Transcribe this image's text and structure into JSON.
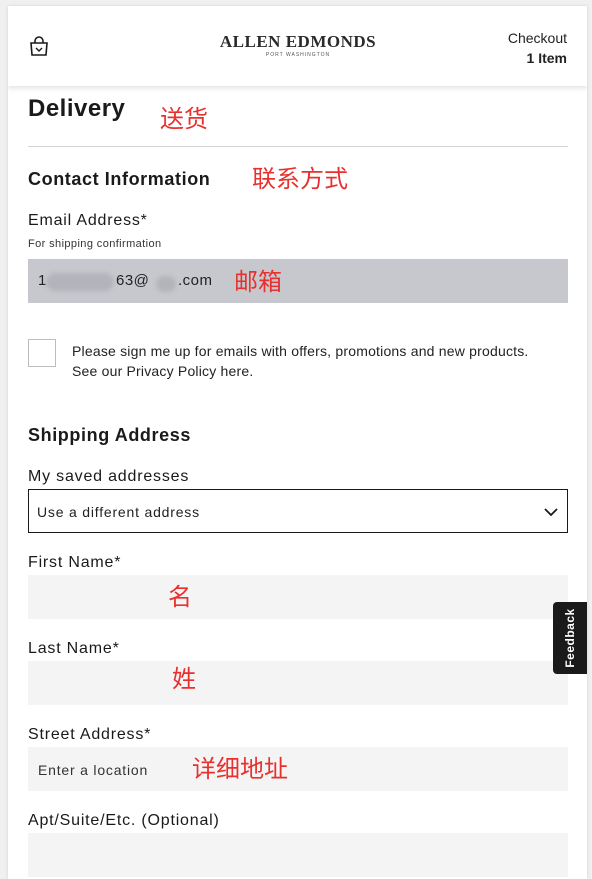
{
  "header": {
    "logo_main": "ALLEN EDMONDS",
    "logo_sub": "PORT WASHINGTON",
    "checkout_label": "Checkout",
    "checkout_items": "1 Item"
  },
  "annotations": {
    "delivery": "送货",
    "contact": "联系方式",
    "email": "邮箱",
    "first_name": "名",
    "last_name": "姓",
    "street": "详细地址"
  },
  "delivery": {
    "title": "Delivery"
  },
  "contact": {
    "title": "Contact Information",
    "email_label": "Email Address*",
    "email_hint": "For shipping confirmation",
    "email_value_start": "1",
    "email_value_mid": "63@",
    "email_value_end": ".com",
    "consent_text": "Please sign me up for emails with offers, promotions and new products. See our Privacy Policy here."
  },
  "shipping": {
    "title": "Shipping Address",
    "saved_label": "My saved addresses",
    "saved_value": "Use a different address",
    "first_name_label": "First Name*",
    "last_name_label": "Last Name*",
    "street_label": "Street Address*",
    "street_placeholder": "Enter a location",
    "apt_label": "Apt/Suite/Etc. (Optional)"
  },
  "feedback": {
    "label": "Feedback"
  },
  "icons": {
    "bag": "shopping-bag-icon",
    "chevron": "chevron-down-icon"
  },
  "colors": {
    "annotation": "#e8312f",
    "email_field_bg": "#c7c8ce",
    "field_bg": "#f4f4f4",
    "feedback_bg": "#1a1a1a"
  }
}
